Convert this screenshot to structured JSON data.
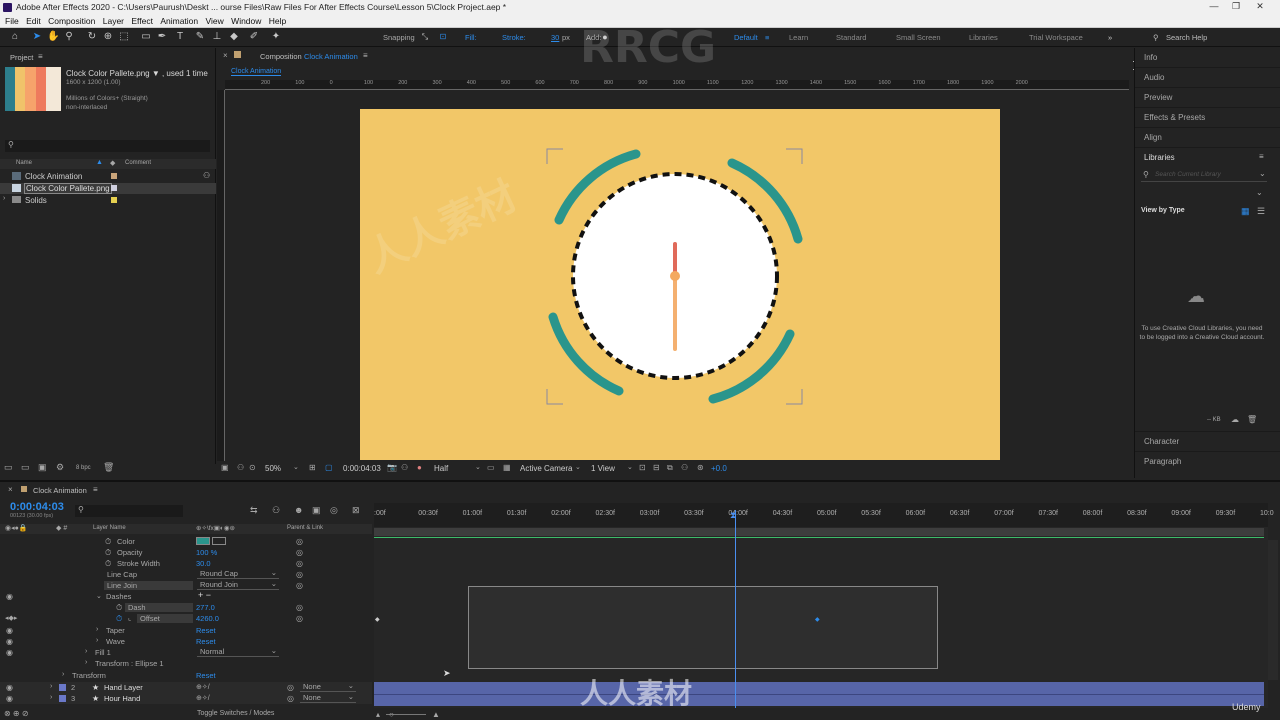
{
  "app": {
    "title": "Adobe After Effects 2020 - C:\\Users\\Paurush\\Deskt ... ourse Files\\Raw Files For After Effects Course\\Lesson 5\\Clock Project.aep *"
  },
  "menu": [
    "File",
    "Edit",
    "Composition",
    "Layer",
    "Effect",
    "Animation",
    "View",
    "Window",
    "Help"
  ],
  "toolbar": {
    "snapping": "Snapping",
    "fill": "Fill:",
    "stroke": "Stroke:",
    "stroke_width": "30",
    "stroke_unit": "px",
    "add": "Add:",
    "workspaces": [
      "Default",
      "Learn",
      "Standard",
      "Small Screen",
      "Libraries",
      "Trial Workspace"
    ],
    "search": "Search Help",
    "fill_color": "#ffffff",
    "stroke_color": "#2a8a86"
  },
  "project": {
    "tab": "Project",
    "asset_name": "Clock Color Pallete.png ▼ , used 1 time",
    "asset_dims": "1600 x 1200 (1.00)",
    "asset_colors": "Millions of Colors+ (Straight)",
    "asset_interlace": "non-interlaced",
    "col_name": "Name",
    "col_comment": "Comment",
    "items": [
      "Clock Animation",
      "Clock Color Pallete.png",
      "Solids"
    ],
    "bpc": "8 bpc"
  },
  "comp": {
    "tab_prefix": "Composition",
    "tab_name": "Clock Animation",
    "subtab": "Clock Animation",
    "zoom": "50%",
    "timecode": "0:00:04:03",
    "resolution": "Half",
    "camera": "Active Camera",
    "view": "1 View",
    "exposure": "+0.0",
    "bg_color": "#f2c768",
    "ring_color": "#2a958c"
  },
  "ruler": [
    "200",
    "100",
    "0",
    "100",
    "200",
    "300",
    "400",
    "500",
    "600",
    "700",
    "800",
    "900",
    "1000",
    "1100",
    "1200",
    "1300",
    "1400",
    "1500",
    "1600",
    "1700",
    "1800",
    "1900",
    "2000"
  ],
  "right": {
    "items": [
      "Info",
      "Audio",
      "Preview",
      "Effects & Presets",
      "Align",
      "Libraries"
    ],
    "search_placeholder": "Search Current Library",
    "view_by": "View by Type",
    "cc_message": "To use Creative Cloud Libraries, you need to be logged into a Creative Cloud account.",
    "kb": "-- KB",
    "bottom": [
      "Character",
      "Paragraph"
    ]
  },
  "timeline": {
    "tab": "Clock Animation",
    "timecode": "0:00:04:03",
    "fps": "00123 (30.00 fps)",
    "col_layer": "Layer Name",
    "col_parent": "Parent & Link",
    "toggle": "Toggle Switches / Modes",
    "ticks": [
      ":00f",
      "00:30f",
      "01:00f",
      "01:30f",
      "02:00f",
      "02:30f",
      "03:00f",
      "03:30f",
      "04:00f",
      "04:30f",
      "05:00f",
      "05:30f",
      "06:00f",
      "06:30f",
      "07:00f",
      "07:30f",
      "08:00f",
      "08:30f",
      "09:00f",
      "09:30f",
      "10:0"
    ],
    "props": [
      {
        "name": "Color",
        "value": ""
      },
      {
        "name": "Opacity",
        "value": "100 %"
      },
      {
        "name": "Stroke Width",
        "value": "30.0"
      },
      {
        "name": "Line Cap",
        "value": "Round Cap"
      },
      {
        "name": "Line Join",
        "value": "Round Join"
      },
      {
        "name": "Dashes",
        "value": "+ −"
      },
      {
        "name": "Dash",
        "value": "277.0"
      },
      {
        "name": "Offset",
        "value": "4260.0"
      },
      {
        "name": "Taper",
        "value": "Reset"
      },
      {
        "name": "Wave",
        "value": "Reset"
      },
      {
        "name": "Fill 1",
        "value": "Normal"
      },
      {
        "name": "Transform : Ellipse 1",
        "value": ""
      },
      {
        "name": "Transform",
        "value": "Reset"
      }
    ],
    "layers": [
      {
        "num": "2",
        "name": "Hand Layer",
        "parent": "None"
      },
      {
        "num": "3",
        "name": "Hour Hand",
        "parent": "None"
      }
    ]
  },
  "watermark": {
    "brand": "RRCG",
    "cjk": "人人素材",
    "udemy": "Udemy"
  }
}
